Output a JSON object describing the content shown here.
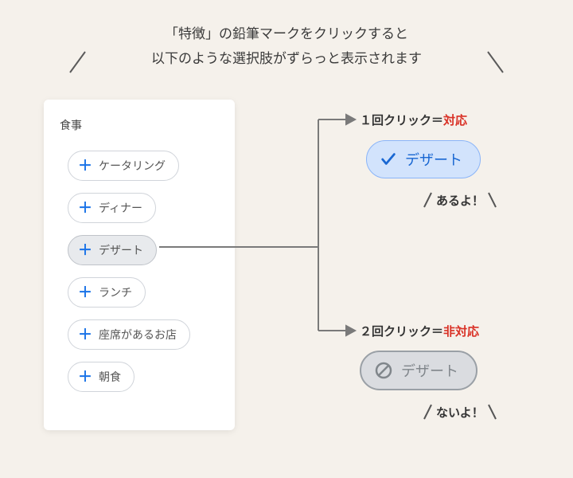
{
  "header": {
    "line1": "「特徴」の鉛筆マークをクリックすると",
    "line2": "以下のような選択肢がずらっと表示されます"
  },
  "panel": {
    "title": "食事",
    "chips": [
      {
        "label": "ケータリング",
        "highlight": false
      },
      {
        "label": "ディナー",
        "highlight": false
      },
      {
        "label": "デザート",
        "highlight": true
      },
      {
        "label": "ランチ",
        "highlight": false
      },
      {
        "label": "座席があるお店",
        "highlight": false
      },
      {
        "label": "朝食",
        "highlight": false
      }
    ]
  },
  "states": {
    "on": {
      "label_prefix": "１回クリック＝",
      "label_word": "対応",
      "chip_text": "デザート",
      "aside": "あるよ！"
    },
    "off": {
      "label_prefix": "２回クリック＝",
      "label_word": "非対応",
      "chip_text": "デザート",
      "aside": "ないよ！"
    }
  }
}
